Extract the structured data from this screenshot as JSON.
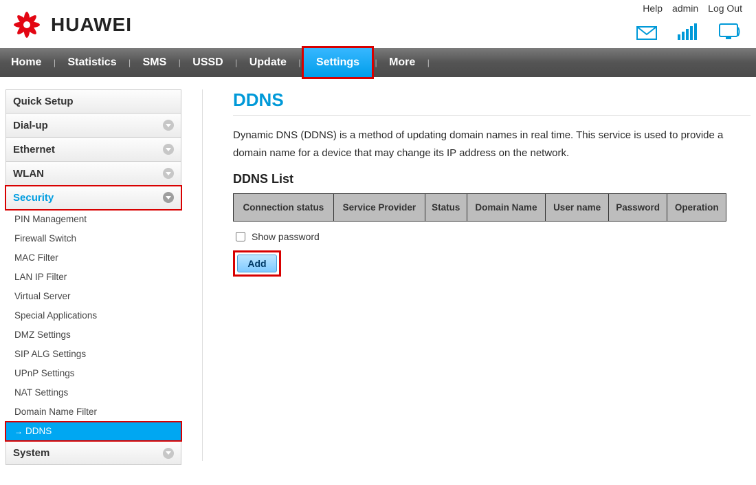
{
  "brand": {
    "name": "HUAWEI"
  },
  "top_links": {
    "help": "Help",
    "user": "admin",
    "logout": "Log Out"
  },
  "nav": {
    "items": [
      "Home",
      "Statistics",
      "SMS",
      "USSD",
      "Update",
      "Settings",
      "More"
    ],
    "active_index": 5
  },
  "sidebar": {
    "categories": [
      {
        "label": "Quick Setup",
        "expandable": false
      },
      {
        "label": "Dial-up",
        "expandable": true
      },
      {
        "label": "Ethernet",
        "expandable": true
      },
      {
        "label": "WLAN",
        "expandable": true
      },
      {
        "label": "Security",
        "expandable": true,
        "active": true,
        "highlight": true
      },
      {
        "label": "System",
        "expandable": true
      }
    ],
    "security_items": [
      "PIN Management",
      "Firewall Switch",
      "MAC Filter",
      "LAN IP Filter",
      "Virtual Server",
      "Special Applications",
      "DMZ Settings",
      "SIP ALG Settings",
      "UPnP Settings",
      "NAT Settings",
      "Domain Name Filter",
      "DDNS"
    ],
    "security_selected_index": 11
  },
  "content": {
    "title": "DDNS",
    "description": "Dynamic DNS (DDNS) is a method of updating domain names in real time. This service is used to provide a domain name for a device that may change its IP address on the network.",
    "list_title": "DDNS List",
    "columns": [
      "Connection status",
      "Service Provider",
      "Status",
      "Domain Name",
      "User name",
      "Password",
      "Operation"
    ],
    "show_password_label": "Show password",
    "add_label": "Add"
  }
}
